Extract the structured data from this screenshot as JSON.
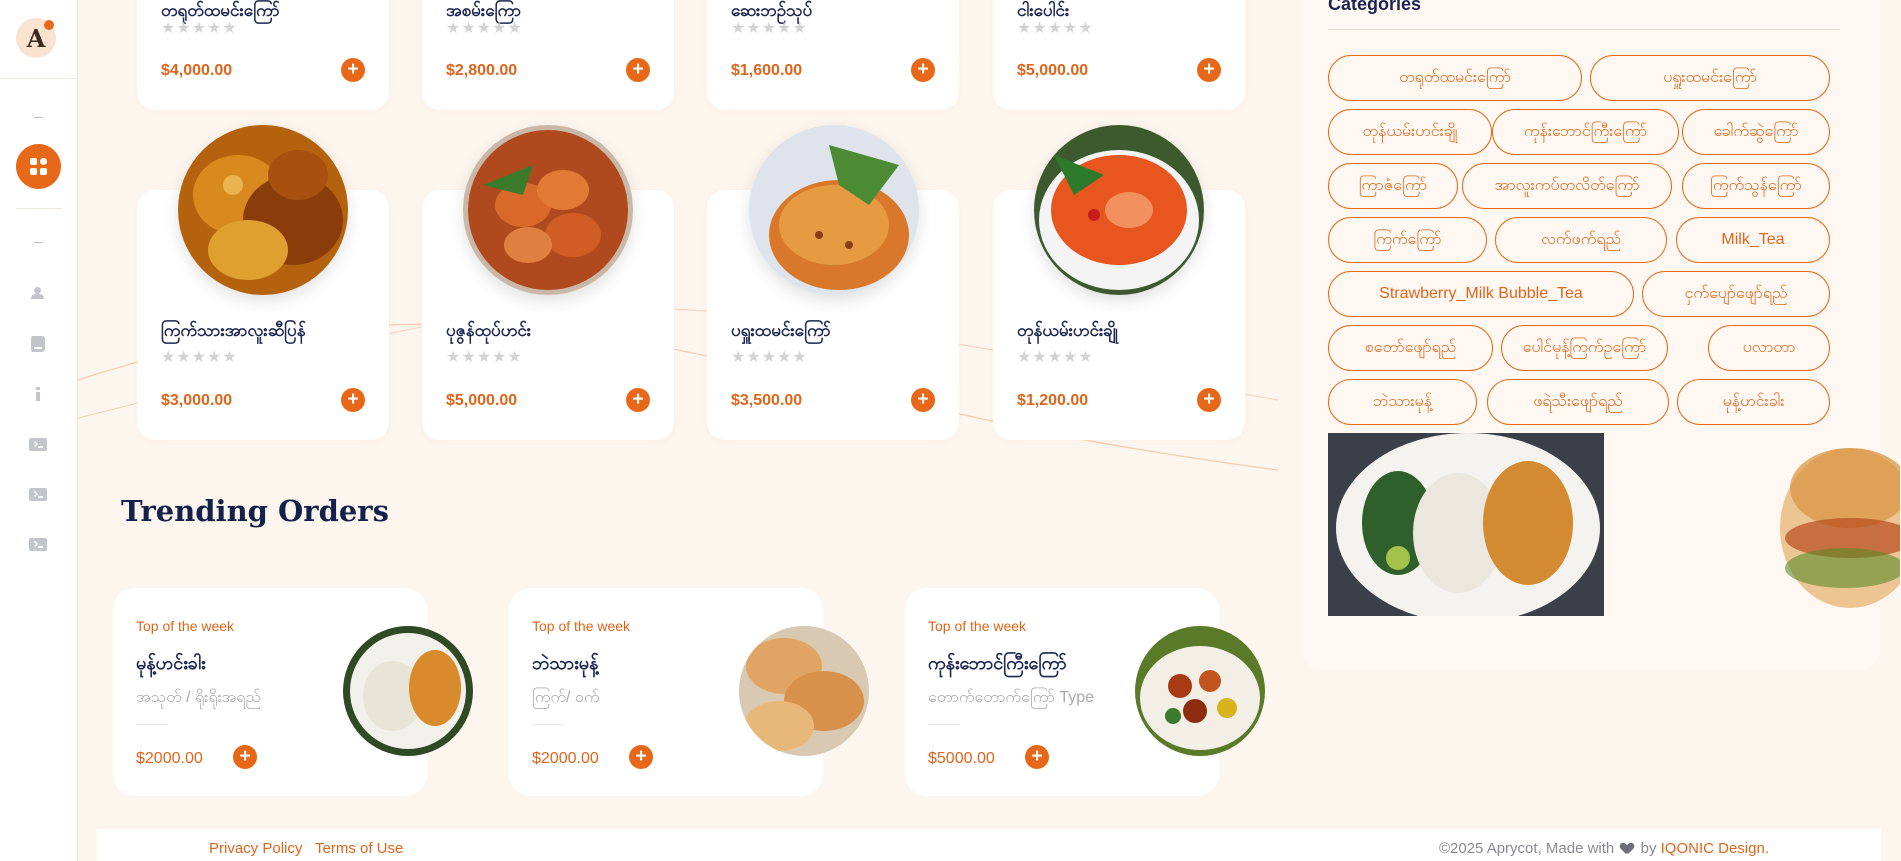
{
  "sidebar": {
    "logo_letter": "A",
    "accent": "#e8681a"
  },
  "menu": {
    "top_row": [
      {
        "name": "တရုတ်ထမင်းကြော်",
        "price": "$4,000.00",
        "rating": 0
      },
      {
        "name": "အစမ်းကြော",
        "price": "$2,800.00",
        "rating": 0
      },
      {
        "name": "ဆေးဘဉ်သုပ်",
        "price": "$1,600.00",
        "rating": 0
      },
      {
        "name": "ငါးပေါင်း",
        "price": "$5,000.00",
        "rating": 0
      }
    ],
    "second_row": [
      {
        "name": "ကြက်သားအာလူးဆီပြန်",
        "price": "$3,000.00",
        "rating": 0,
        "image": "chicken-curry"
      },
      {
        "name": "ပုဇွန်ထုပ်ဟင်း",
        "price": "$5,000.00",
        "rating": 0,
        "image": "prawn-curry"
      },
      {
        "name": "ပရှူးထမင်းကြော်",
        "price": "$3,500.00",
        "rating": 0,
        "image": "fried-rice"
      },
      {
        "name": "တုန်ယမ်းဟင်းချို",
        "price": "$1,200.00",
        "rating": 0,
        "image": "tom-yum"
      }
    ],
    "star_glyph": "★★★★★",
    "add_glyph": "+"
  },
  "trending": {
    "title": "Trending Orders",
    "items": [
      {
        "tag": "Top of the week",
        "name": "မုန့်ဟင်းခါး",
        "subtitle": "အသုတ် / ရိုးရိုးအရည်",
        "price": "$2000.00"
      },
      {
        "tag": "Top of the week",
        "name": "ဘဲသားမုန့်",
        "subtitle": "ကြက်/ ဝက်",
        "price": "$2000.00"
      },
      {
        "tag": "Top of the week",
        "name": "ကုန်းဘောင်ကြီးကြော်",
        "subtitle": "တောက်တောက်ကြော် Type",
        "price": "$5000.00"
      }
    ]
  },
  "categories": {
    "heading": "Categories",
    "pills": [
      "တရုတ်ထမင်းကြော်",
      "ပရှူးထမင်းကြော်",
      "တုန်ယမ်းဟင်းချို",
      "ကုန်းဘောင်ကြီးကြော်",
      "ခေါက်ဆွဲကြော်",
      "ကြာဇံကြော်",
      "အာလူးကပ်တလိတ်ကြော်",
      "ကြက်သွန်ကြော်",
      "ကြက်ကြော်",
      "လက်ဖက်ရည်",
      "Milk_Tea",
      "Strawberry_Milk Bubble_Tea",
      "ငှက်ပျော်ဖျော်ရည်",
      "စတော်ဖျော်ရည်",
      "ပေါင်မုန့်ကြက်ဥကြော်",
      "ပလာတာ",
      "ဘဲသားမုန့်",
      "ဖရဲသီးဖျော်ရည်",
      "မုန့်ဟင်းခါး"
    ]
  },
  "footer": {
    "privacy": "Privacy Policy",
    "terms": "Terms of Use",
    "copyright_prefix": "©2025 Aprycot, Made with",
    "by": "by",
    "brand": "IQONIC Design."
  }
}
